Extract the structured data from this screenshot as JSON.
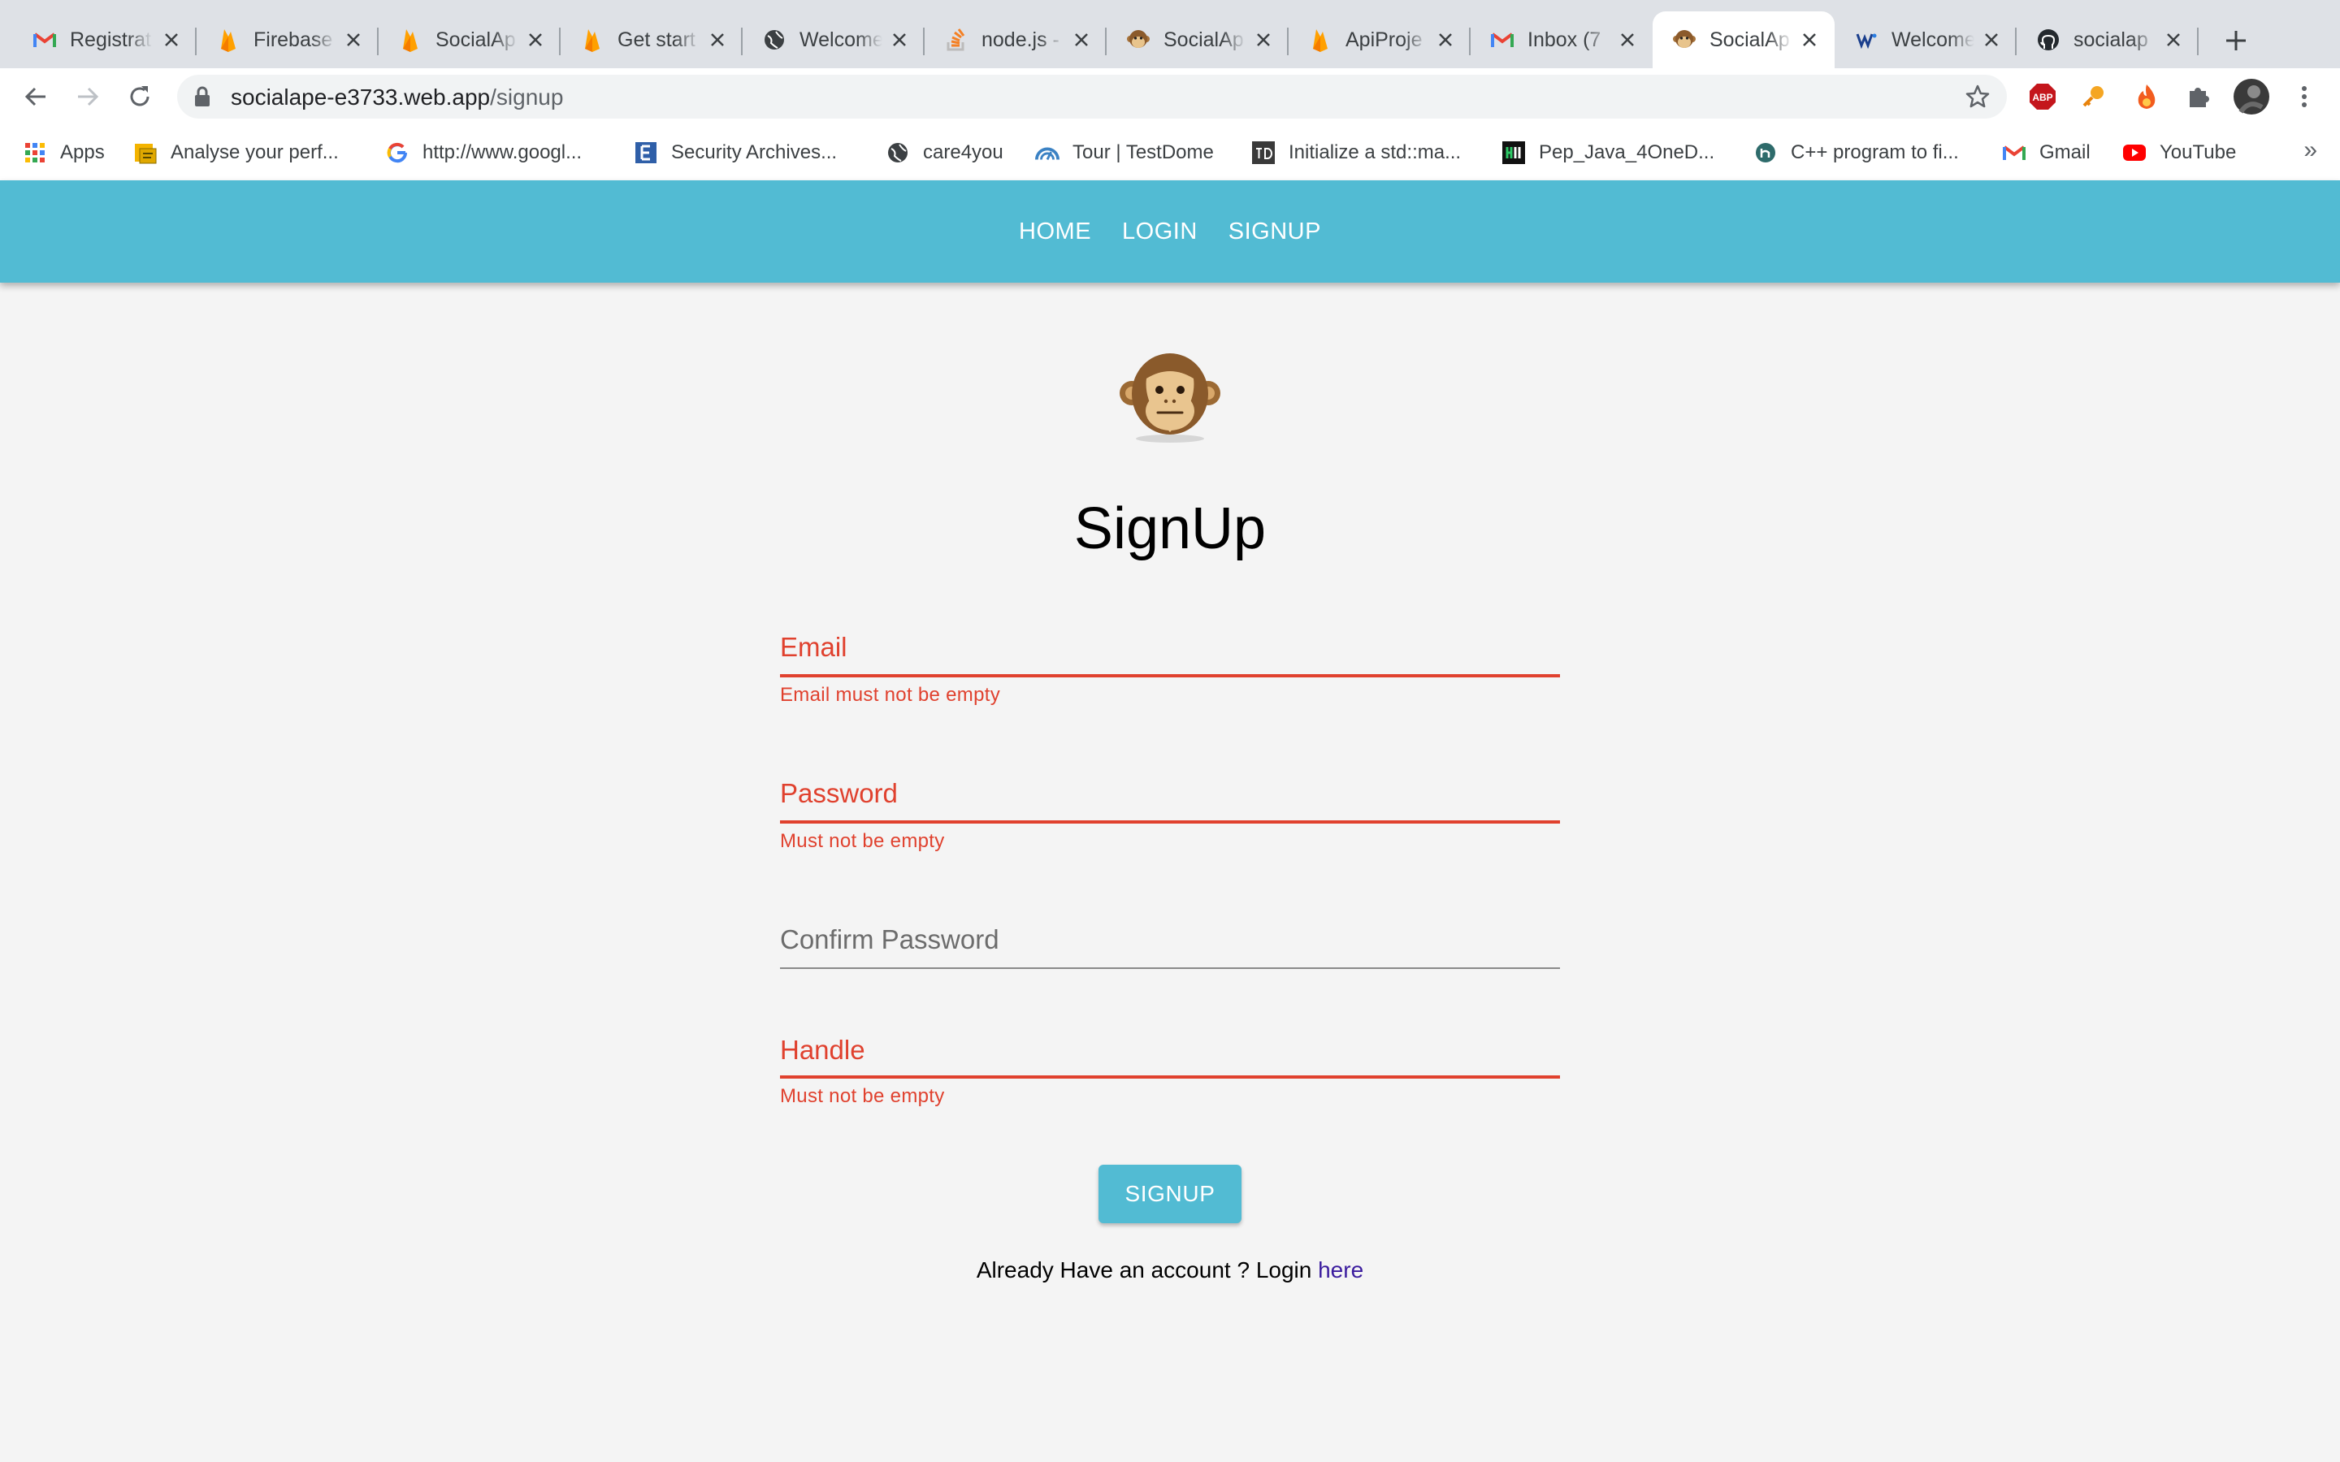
{
  "browser": {
    "tabs": [
      {
        "title": "Registrat",
        "icon": "gmail-icon"
      },
      {
        "title": "Firebase",
        "icon": "firebase-icon"
      },
      {
        "title": "SocialAp",
        "icon": "firebase-icon"
      },
      {
        "title": "Get start",
        "icon": "firebase-icon"
      },
      {
        "title": "Welcome",
        "icon": "globe-icon"
      },
      {
        "title": "node.js -",
        "icon": "stackoverflow-icon"
      },
      {
        "title": "SocialAp",
        "icon": "monkey-icon"
      },
      {
        "title": "ApiProje",
        "icon": "firebase-icon"
      },
      {
        "title": "Inbox (7",
        "icon": "gmail-icon"
      },
      {
        "title": "SocialAp",
        "icon": "monkey-icon",
        "active": true
      },
      {
        "title": "Welcome",
        "icon": "logo-icon"
      },
      {
        "title": "socialap",
        "icon": "github-icon"
      }
    ],
    "url_host": "socialape-e3733.web.app",
    "url_path": "/signup",
    "bookmarks": [
      {
        "label": "Apps",
        "icon": "apps-grid-icon"
      },
      {
        "label": "Analyse your perf...",
        "icon": "folder-icon"
      },
      {
        "label": "http://www.googl...",
        "icon": "google-icon"
      },
      {
        "label": "Security Archives...",
        "icon": "site-icon"
      },
      {
        "label": "care4you",
        "icon": "globe-icon"
      },
      {
        "label": "Tour | TestDome",
        "icon": "testdome-icon"
      },
      {
        "label": "Initialize a std::ma...",
        "icon": "td-icon"
      },
      {
        "label": "Pep_Java_4OneD...",
        "icon": "hackerrank-icon"
      },
      {
        "label": "C++ program to fi...",
        "icon": "site-icon"
      },
      {
        "label": "Gmail",
        "icon": "gmail-icon"
      },
      {
        "label": "YouTube",
        "icon": "youtube-icon"
      }
    ],
    "bookmarks_more": "»",
    "extensions": {
      "adblock_label": "ABP"
    }
  },
  "navbar": {
    "home": "HOME",
    "login": "LOGIN",
    "signup": "SIGNUP"
  },
  "form": {
    "title": "SignUp",
    "email": {
      "label": "Email",
      "error": "Email must not be empty"
    },
    "password": {
      "label": "Password",
      "error": "Must not be empty"
    },
    "confirm_password": {
      "label": "Confirm Password"
    },
    "handle": {
      "label": "Handle",
      "error": "Must not be empty"
    },
    "submit_label": "SIGNUP",
    "login_prompt": "Already Have an account ? Login",
    "login_link": "here"
  },
  "colors": {
    "primary": "#52bbd3",
    "error": "#e0412e",
    "background": "#f4f4f4"
  }
}
